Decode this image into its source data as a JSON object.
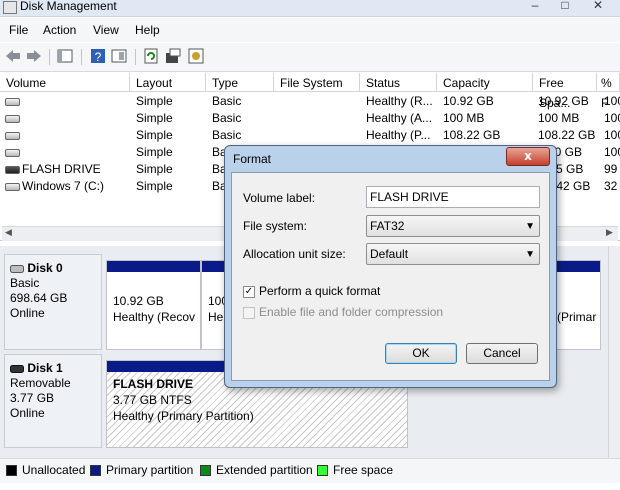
{
  "window": {
    "title": "Disk Management",
    "controls": {
      "minimize": "–",
      "maximize": "□",
      "close": "✕"
    }
  },
  "menu": [
    "File",
    "Action",
    "View",
    "Help"
  ],
  "toolbar": {
    "icons": [
      "back-arrow",
      "forward-arrow",
      "console-tree",
      "help",
      "properties",
      "refresh",
      "rescan",
      "settings"
    ]
  },
  "volume_list": {
    "columns": [
      "Volume",
      "Layout",
      "Type",
      "File System",
      "Status",
      "Capacity",
      "Free Spa...",
      "% F"
    ],
    "rows": [
      {
        "volume": "",
        "layout": "Simple",
        "type": "Basic",
        "fs": "",
        "status": "Healthy (R...",
        "capacity": "10.92 GB",
        "free": "10.92 GB",
        "pct": "100"
      },
      {
        "volume": "",
        "layout": "Simple",
        "type": "Basic",
        "fs": "",
        "status": "Healthy (A...",
        "capacity": "100 MB",
        "free": "100 MB",
        "pct": "100"
      },
      {
        "volume": "",
        "layout": "Simple",
        "type": "Basic",
        "fs": "",
        "status": "Healthy (P...",
        "capacity": "108.22 GB",
        "free": "108.22 GB",
        "pct": "100"
      },
      {
        "volume": "",
        "layout": "Simple",
        "type": "Ba",
        "fs": "",
        "status": "",
        "capacity": "",
        "free": "00 GB",
        "pct": "100"
      },
      {
        "volume": "FLASH DRIVE",
        "layout": "Simple",
        "type": "Ba",
        "fs": "",
        "status": "",
        "capacity": "",
        "free": "5 GB",
        "pct": "99"
      },
      {
        "volume": "Windows 7 (C:)",
        "layout": "Simple",
        "type": "Ba",
        "fs": "",
        "status": "",
        "capacity": "",
        "free": ".42 GB",
        "pct": "32"
      }
    ]
  },
  "disks": [
    {
      "name": "Disk 0",
      "kind": "Basic",
      "size": "698.64 GB",
      "state": "Online",
      "partitions": [
        {
          "size": "10.92 GB",
          "status": "Healthy (Recov"
        },
        {
          "size": "100",
          "status": "He"
        },
        {
          "size": "",
          "status": "(Primar"
        }
      ]
    },
    {
      "name": "Disk 1",
      "kind": "Removable",
      "size": "3.77 GB",
      "state": "Online",
      "partitions": [
        {
          "label": "FLASH DRIVE",
          "size": "3.77 GB NTFS",
          "status": "Healthy (Primary Partition)"
        }
      ]
    }
  ],
  "legend": [
    {
      "label": "Unallocated",
      "color": "#000000"
    },
    {
      "label": "Primary partition",
      "color": "#0b1a89"
    },
    {
      "label": "Extended partition",
      "color": "#0a8a1a"
    },
    {
      "label": "Free space",
      "color": "#33ff33"
    }
  ],
  "format_dialog": {
    "title": "Format",
    "close": "x",
    "volume_label_text": "Volume label:",
    "volume_label_value": "FLASH DRIVE",
    "file_system_text": "File system:",
    "file_system_value": "FAT32",
    "alloc_text": "Allocation unit size:",
    "alloc_value": "Default",
    "quick_format_text": "Perform a quick format",
    "quick_format_checked": true,
    "compression_text": "Enable file and folder compression",
    "compression_checked": false,
    "ok": "OK",
    "cancel": "Cancel"
  }
}
